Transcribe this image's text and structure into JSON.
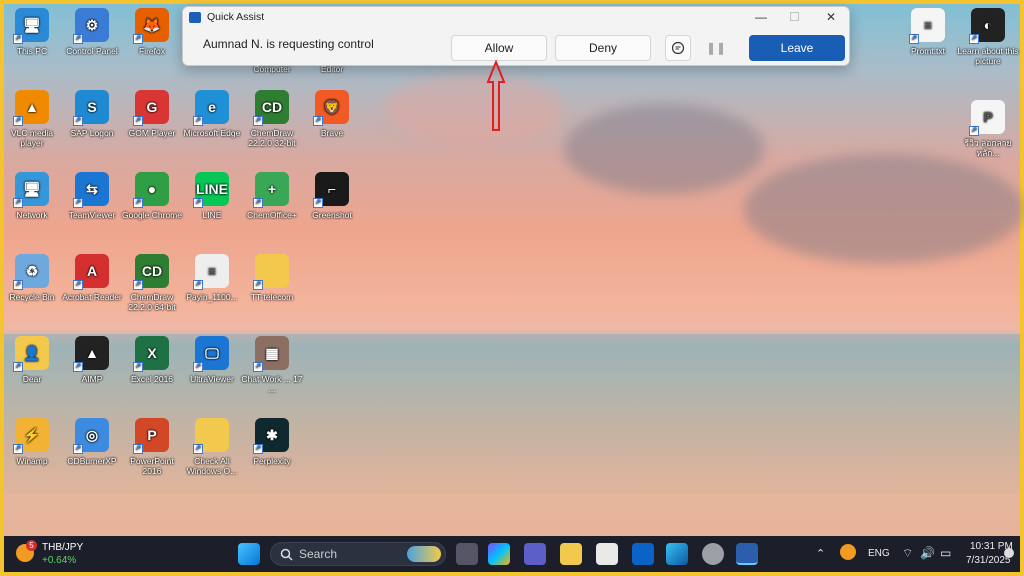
{
  "desktop": [
    {
      "label": "This PC",
      "color": "#2b8ad6",
      "glyph": "🖥"
    },
    {
      "label": "Control Panel",
      "color": "#3a7bd5",
      "glyph": "⚙"
    },
    {
      "label": "Firefox",
      "color": "#e66000",
      "glyph": "🦊"
    },
    {
      "label": "VLC media player",
      "color": "#f08a00",
      "glyph": "▲"
    },
    {
      "label": "SAP Logon",
      "color": "#1f8ad1",
      "glyph": "S"
    },
    {
      "label": "GOM Player",
      "color": "#d93535",
      "glyph": "G"
    },
    {
      "label": "Microsoft Edge",
      "color": "#1f8fd6",
      "glyph": "e"
    },
    {
      "label": "ChemDraw 22.2.0 32-bit",
      "color": "#2e7d32",
      "glyph": "CD"
    },
    {
      "label": "Brave",
      "color": "#f15a24",
      "glyph": "🦁"
    },
    {
      "label": "Network",
      "color": "#3596d8",
      "glyph": "🖥"
    },
    {
      "label": "TeamViewer",
      "color": "#1a76d2",
      "glyph": "⇆"
    },
    {
      "label": "Google Chrome",
      "color": "#2f9e44",
      "glyph": "●"
    },
    {
      "label": "LINE",
      "color": "#06c755",
      "glyph": "LINE"
    },
    {
      "label": "ChemOffice+",
      "color": "#3aa757",
      "glyph": "+"
    },
    {
      "label": "Greenshot",
      "color": "#1a1a1a",
      "glyph": "⌐"
    },
    {
      "label": "Recycle Bin",
      "color": "#6fa8dc",
      "glyph": "♻"
    },
    {
      "label": "Acrobat Reader",
      "color": "#d32f2f",
      "glyph": "A"
    },
    {
      "label": "ChemDraw 22.2.0 64-bit",
      "color": "#2e7d32",
      "glyph": "CD"
    },
    {
      "label": "Payin_1100...",
      "color": "#eeeeee",
      "glyph": "≡"
    },
    {
      "label": "TT-telecom",
      "color": "#f2c94c",
      "glyph": ""
    },
    {
      "label": "Dear",
      "color": "#f2c94c",
      "glyph": "👤"
    },
    {
      "label": "AIMP",
      "color": "#222",
      "glyph": "▲"
    },
    {
      "label": "Excel 2016",
      "color": "#1e7145",
      "glyph": "X"
    },
    {
      "label": "UltraViewer",
      "color": "#1a76d2",
      "glyph": "🖵"
    },
    {
      "label": "Chat Work ... 17 ...",
      "color": "#8d6e63",
      "glyph": "▦"
    },
    {
      "label": "Winamp",
      "color": "#f2b233",
      "glyph": "⚡"
    },
    {
      "label": "CDBurnerXP",
      "color": "#3d8be0",
      "glyph": "◎"
    },
    {
      "label": "PowerPoint 2016",
      "color": "#d24726",
      "glyph": "P"
    },
    {
      "label": "Check All Windows O...",
      "color": "#f2c94c",
      "glyph": ""
    },
    {
      "label": "Perplexity",
      "color": "#0f2a2e",
      "glyph": "✱"
    }
  ],
  "desktop_right": [
    {
      "label": "Promt.txt",
      "color": "#f5f5f5",
      "glyph": "≡"
    },
    {
      "label": "Learn about this picture",
      "color": "#222",
      "glyph": "◐"
    },
    {
      "label": "รีวิว ลอกลายหลัก...",
      "color": "#f5f5f5",
      "glyph": "P"
    }
  ],
  "partial_labels": [
    "Computer",
    "Editor"
  ],
  "quick_assist": {
    "title": "Quick Assist",
    "message": "Aumnad N. is requesting control",
    "allow": "Allow",
    "deny": "Deny",
    "leave": "Leave",
    "minimize": "—",
    "maximize": "☐",
    "close": "✕"
  },
  "taskbar": {
    "widget_symbol": "THB/JPY",
    "widget_change": "+0.64%",
    "widget_badge": "5",
    "search_placeholder": "Search",
    "language": "ENG",
    "time": "10:31 PM",
    "date": "7/31/2025"
  }
}
